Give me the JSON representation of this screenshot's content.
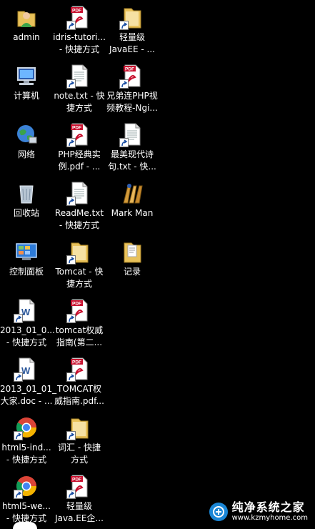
{
  "desktop": {
    "icons": [
      {
        "label": "admin",
        "type": "user-folder"
      },
      {
        "label": "idris-tutori...\n- 快捷方式",
        "type": "pdf-shortcut"
      },
      {
        "label": "轻量级\nJavaEE - ...",
        "type": "folder-shortcut"
      },
      {
        "label": "计算机",
        "type": "computer"
      },
      {
        "label": "note.txt - 快\n捷方式",
        "type": "txt-shortcut"
      },
      {
        "label": "兄弟连PHP视\n频教程-Ngi...",
        "type": "pdf-shortcut"
      },
      {
        "label": "网络",
        "type": "network"
      },
      {
        "label": "PHP经典实\n例.pdf - ...",
        "type": "pdf-shortcut"
      },
      {
        "label": "最美现代诗\n句.txt - 快...",
        "type": "txt-shortcut"
      },
      {
        "label": "回收站",
        "type": "recycle-bin"
      },
      {
        "label": "ReadMe.txt\n- 快捷方式",
        "type": "txt-shortcut"
      },
      {
        "label": "Mark Man",
        "type": "markman"
      },
      {
        "label": "控制面板",
        "type": "control-panel"
      },
      {
        "label": "Tomcat - 快\n捷方式",
        "type": "folder-shortcut"
      },
      {
        "label": "记录",
        "type": "doc-folder"
      },
      {
        "label": "2013_01_0...\n- 快捷方式",
        "type": "word-shortcut"
      },
      {
        "label": "tomcat权威\n指南(第二...",
        "type": "pdf-shortcut"
      },
      {
        "label": "2013_01_01_\n大家.doc - ...",
        "type": "word-shortcut"
      },
      {
        "label": "TOMCAT权\n威指南.pdf...",
        "type": "pdf-shortcut"
      },
      {
        "label": "html5-ind...\n- 快捷方式",
        "type": "chrome-shortcut"
      },
      {
        "label": "词汇 - 快捷\n方式",
        "type": "folder-shortcut"
      },
      {
        "label": "html5-we...\n- 快捷方式",
        "type": "chrome-shortcut"
      },
      {
        "label": "轻量级\nJava.EE企...",
        "type": "pdf-shortcut"
      }
    ]
  },
  "watermark": {
    "title": "纯净系统之家",
    "url": "www.kzmyhome.com"
  },
  "colors": {
    "background": "#000000",
    "label_text": "#ffffff",
    "pdf_red": "#c8102e",
    "folder_yellow": "#e8c15a",
    "chrome_red": "#db4437",
    "chrome_yellow": "#f4b400",
    "chrome_green": "#0f9d58",
    "chrome_blue": "#4285f4"
  }
}
